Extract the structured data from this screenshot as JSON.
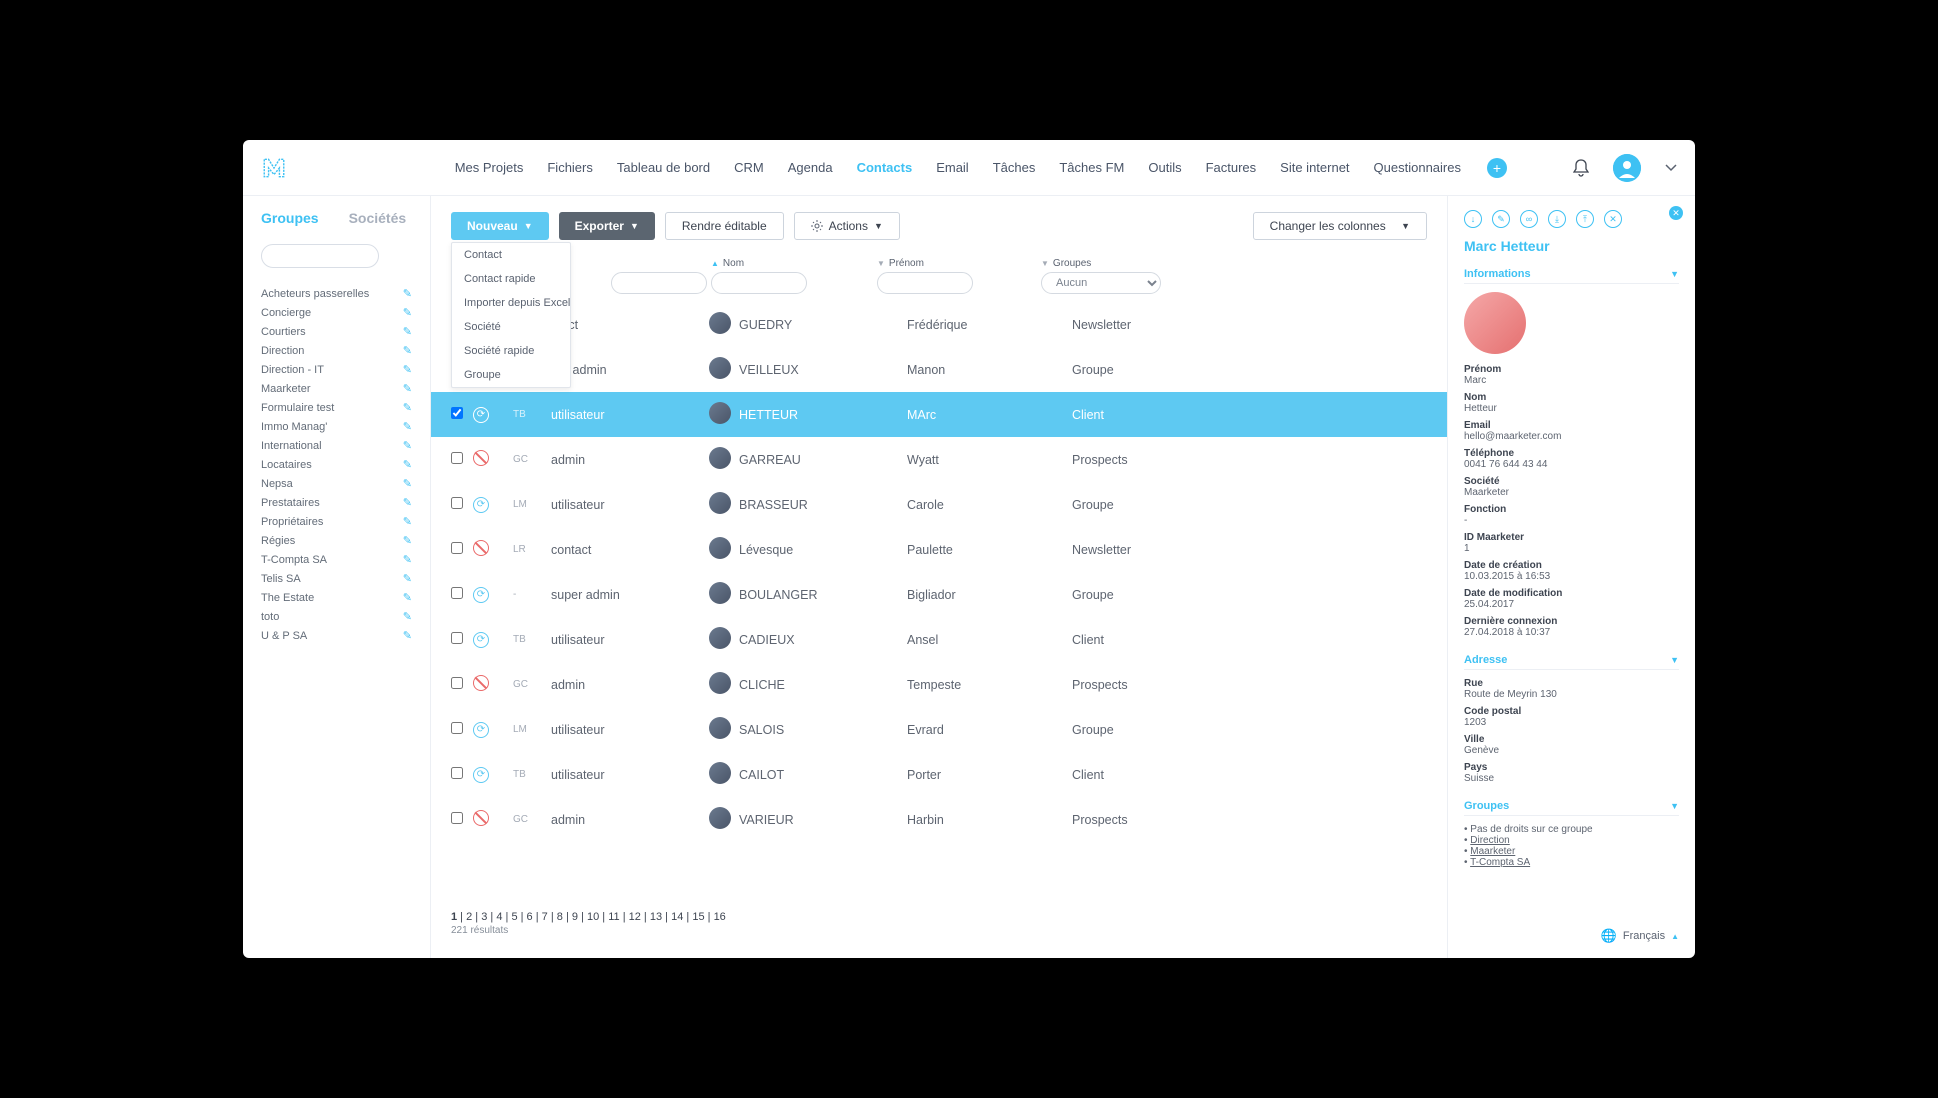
{
  "nav": {
    "items": [
      "Mes Projets",
      "Fichiers",
      "Tableau de bord",
      "CRM",
      "Agenda",
      "Contacts",
      "Email",
      "Tâches",
      "Tâches FM",
      "Outils",
      "Factures",
      "Site internet",
      "Questionnaires"
    ],
    "active_index": 5
  },
  "sidebar_left": {
    "tabs": [
      "Groupes",
      "Sociétés"
    ],
    "active_index": 0,
    "groups": [
      "Acheteurs passerelles",
      "Concierge",
      "Courtiers",
      "Direction",
      "Direction - IT",
      "Maarketer",
      "Formulaire test",
      "Immo Manag'",
      "International",
      "Locataires",
      "Nepsa",
      "Prestataires",
      "Propriétaires",
      "Régies",
      "T-Compta SA",
      "Telis SA",
      "The Estate",
      "toto",
      "U & P SA"
    ]
  },
  "toolbar": {
    "nouveau": "Nouveau",
    "exporter": "Exporter",
    "editable": "Rendre éditable",
    "actions": "Actions",
    "columns": "Changer les colonnes",
    "dropdown": [
      "Contact",
      "Contact rapide",
      "Importer depuis Excel",
      "Société",
      "Société rapide",
      "Groupe"
    ]
  },
  "columns": {
    "nom": "Nom",
    "prenom": "Prénom",
    "groupes": "Groupes",
    "groupe_filter": "Aucun"
  },
  "rows": [
    {
      "status": "blue",
      "init": "",
      "role": "ntact",
      "nom": "GUEDRY",
      "prenom": "Frédérique",
      "groupe": "Newsletter",
      "selected": false
    },
    {
      "status": "blue",
      "init": "",
      "role": "per admin",
      "nom": "VEILLEUX",
      "prenom": "Manon",
      "groupe": "Groupe",
      "selected": false
    },
    {
      "status": "blue",
      "init": "TB",
      "role": "utilisateur",
      "nom": "HETTEUR",
      "prenom": "MArc",
      "groupe": "Client",
      "selected": true
    },
    {
      "status": "red",
      "init": "GC",
      "role": "admin",
      "nom": "GARREAU",
      "prenom": "Wyatt",
      "groupe": "Prospects",
      "selected": false
    },
    {
      "status": "blue",
      "init": "LM",
      "role": "utilisateur",
      "nom": "BRASSEUR",
      "prenom": "Carole",
      "groupe": "Groupe",
      "selected": false
    },
    {
      "status": "red",
      "init": "LR",
      "role": "contact",
      "nom": "Lévesque",
      "prenom": "Paulette",
      "groupe": "Newsletter",
      "selected": false
    },
    {
      "status": "blue",
      "init": "-",
      "role": "super admin",
      "nom": "BOULANGER",
      "prenom": "Bigliador",
      "groupe": "Groupe",
      "selected": false
    },
    {
      "status": "blue",
      "init": "TB",
      "role": "utilisateur",
      "nom": "CADIEUX",
      "prenom": "Ansel",
      "groupe": "Client",
      "selected": false
    },
    {
      "status": "red",
      "init": "GC",
      "role": "admin",
      "nom": "CLICHE",
      "prenom": "Tempeste",
      "groupe": "Prospects",
      "selected": false
    },
    {
      "status": "blue",
      "init": "LM",
      "role": "utilisateur",
      "nom": "SALOIS",
      "prenom": "Evrard",
      "groupe": "Groupe",
      "selected": false
    },
    {
      "status": "blue",
      "init": "TB",
      "role": "utilisateur",
      "nom": "CAILOT",
      "prenom": "Porter",
      "groupe": "Client",
      "selected": false
    },
    {
      "status": "red",
      "init": "GC",
      "role": "admin",
      "nom": "VARIEUR",
      "prenom": "Harbin",
      "groupe": "Prospects",
      "selected": false
    }
  ],
  "pagination": {
    "pages": [
      "1",
      "2",
      "3",
      "4",
      "5",
      "6",
      "7",
      "8",
      "9",
      "10",
      "11",
      "12",
      "13",
      "14",
      "15",
      "16"
    ],
    "active": 0,
    "results": "221 résultats"
  },
  "detail": {
    "title": "Marc Hetteur",
    "sections": {
      "informations": "Informations",
      "adresse": "Adresse",
      "groupes": "Groupes"
    },
    "fields": {
      "prenom_label": "Prénom",
      "prenom": "Marc",
      "nom_label": "Nom",
      "nom": "Hetteur",
      "email_label": "Email",
      "email": "hello@maarketer.com",
      "tel_label": "Téléphone",
      "tel": "0041 76 644 43 44",
      "societe_label": "Société",
      "societe": "Maarketer",
      "fonction_label": "Fonction",
      "fonction": "-",
      "id_label": "ID Maarketer",
      "id": "1",
      "creation_label": "Date de création",
      "creation": "10.03.2015 à 16:53",
      "modif_label": "Date de modification",
      "modif": "25.04.2017",
      "connexion_label": "Dernière connexion",
      "connexion": "27.04.2018 à 10:37",
      "rue_label": "Rue",
      "rue": "Route de Meyrin 130",
      "cp_label": "Code postal",
      "cp": "1203",
      "ville_label": "Ville",
      "ville": "Genève",
      "pays_label": "Pays",
      "pays": "Suisse"
    },
    "groupes_note": "Pas de droits sur ce groupe",
    "groupes_links": [
      "Direction",
      "Maarketer",
      "T-Compta SA"
    ]
  },
  "language": "Français"
}
